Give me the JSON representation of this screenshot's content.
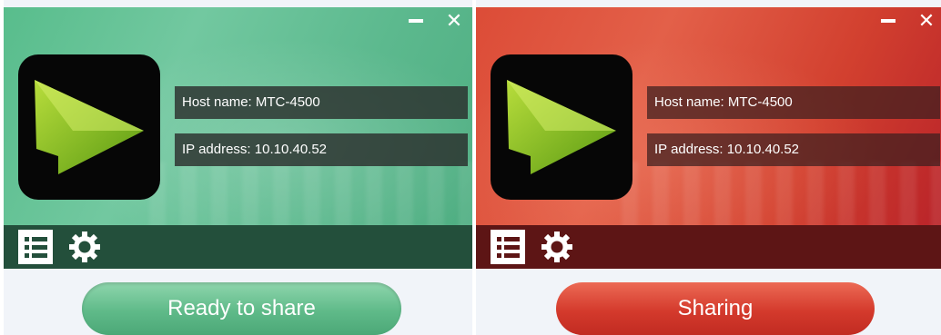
{
  "panels": [
    {
      "state": "ready",
      "theme_color": "#5fba89",
      "window_controls": {
        "minimize_icon": "minimize-icon",
        "close_label": "✕"
      },
      "host_label": "Host name:",
      "host_value": "MTC-4500",
      "ip_label": "IP address:",
      "ip_value": "10.10.40.52",
      "toolbar": {
        "list_icon": "list-icon",
        "settings_icon": "gear-icon"
      },
      "status_button_label": "Ready to share"
    },
    {
      "state": "sharing",
      "theme_color": "#d43a2c",
      "window_controls": {
        "minimize_icon": "minimize-icon",
        "close_label": "✕"
      },
      "host_label": "Host name:",
      "host_value": "MTC-4500",
      "ip_label": "IP address:",
      "ip_value": "10.10.40.52",
      "toolbar": {
        "list_icon": "list-icon",
        "settings_icon": "gear-icon"
      },
      "status_button_label": "Sharing"
    }
  ]
}
